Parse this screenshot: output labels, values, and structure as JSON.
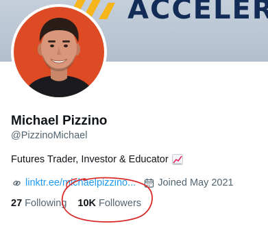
{
  "banner": {
    "text": "ACCELER",
    "logo_icon": "brand-logo-mark",
    "background_color": "#b9c5d3",
    "text_color": "#132b57",
    "mark_color": "#f5b51b"
  },
  "profile": {
    "avatar_icon": "profile-avatar",
    "avatar_background_color": "#dd4b25",
    "display_name": "Michael Pizzino",
    "handle": "@PizzinoMichael",
    "bio": "Futures Trader, Investor & Educator",
    "bio_emoji_icon": "chart-increasing-icon",
    "website": {
      "icon": "link-icon",
      "text": "linktr.ee/michaelpizzino..."
    },
    "joined": {
      "icon": "calendar-icon",
      "text": "Joined May 2021"
    }
  },
  "stats": {
    "following": {
      "count": "27",
      "label": "Following"
    },
    "followers": {
      "count": "10K",
      "label": "Followers"
    }
  },
  "annotation": {
    "shape": "hand-drawn-ellipse",
    "target": "followers",
    "color": "#d92a2a"
  },
  "colors": {
    "primary_text": "#0f1419",
    "secondary_text": "#536471",
    "link": "#1d9bf0"
  }
}
